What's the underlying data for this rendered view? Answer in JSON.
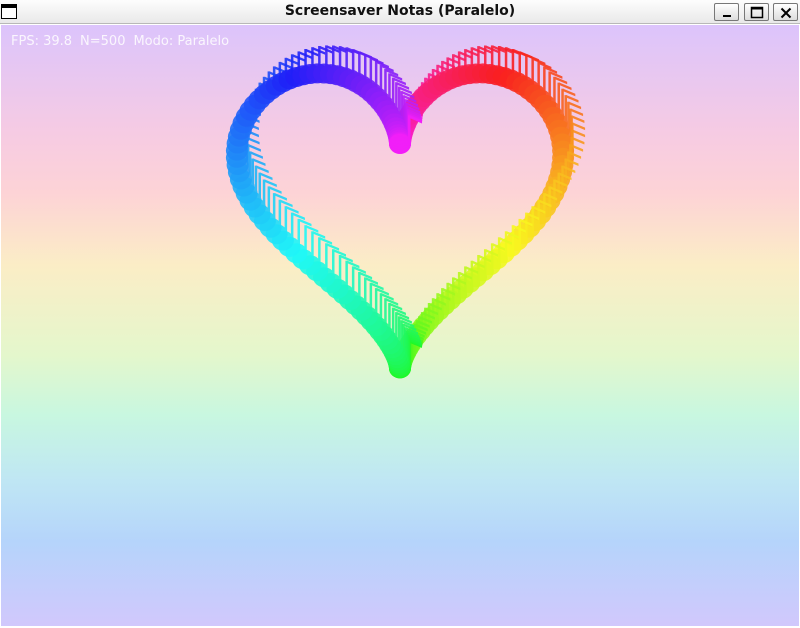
{
  "window": {
    "title": "Screensaver Notas (Paralelo)",
    "controls": [
      "minimize-icon",
      "maximize-icon",
      "close-icon"
    ]
  },
  "hud": {
    "fps": "FPS: 39.8",
    "count": "N=500",
    "mode": "Modo: Paralelo"
  },
  "scene": {
    "shape": "heart",
    "note_icon": "music-note-icon",
    "background_colors": [
      "#dcc4fc",
      "#fdd3d6",
      "#fbedc6",
      "#c8f7e0",
      "#b5d4fb",
      "#d1c8fc"
    ]
  }
}
